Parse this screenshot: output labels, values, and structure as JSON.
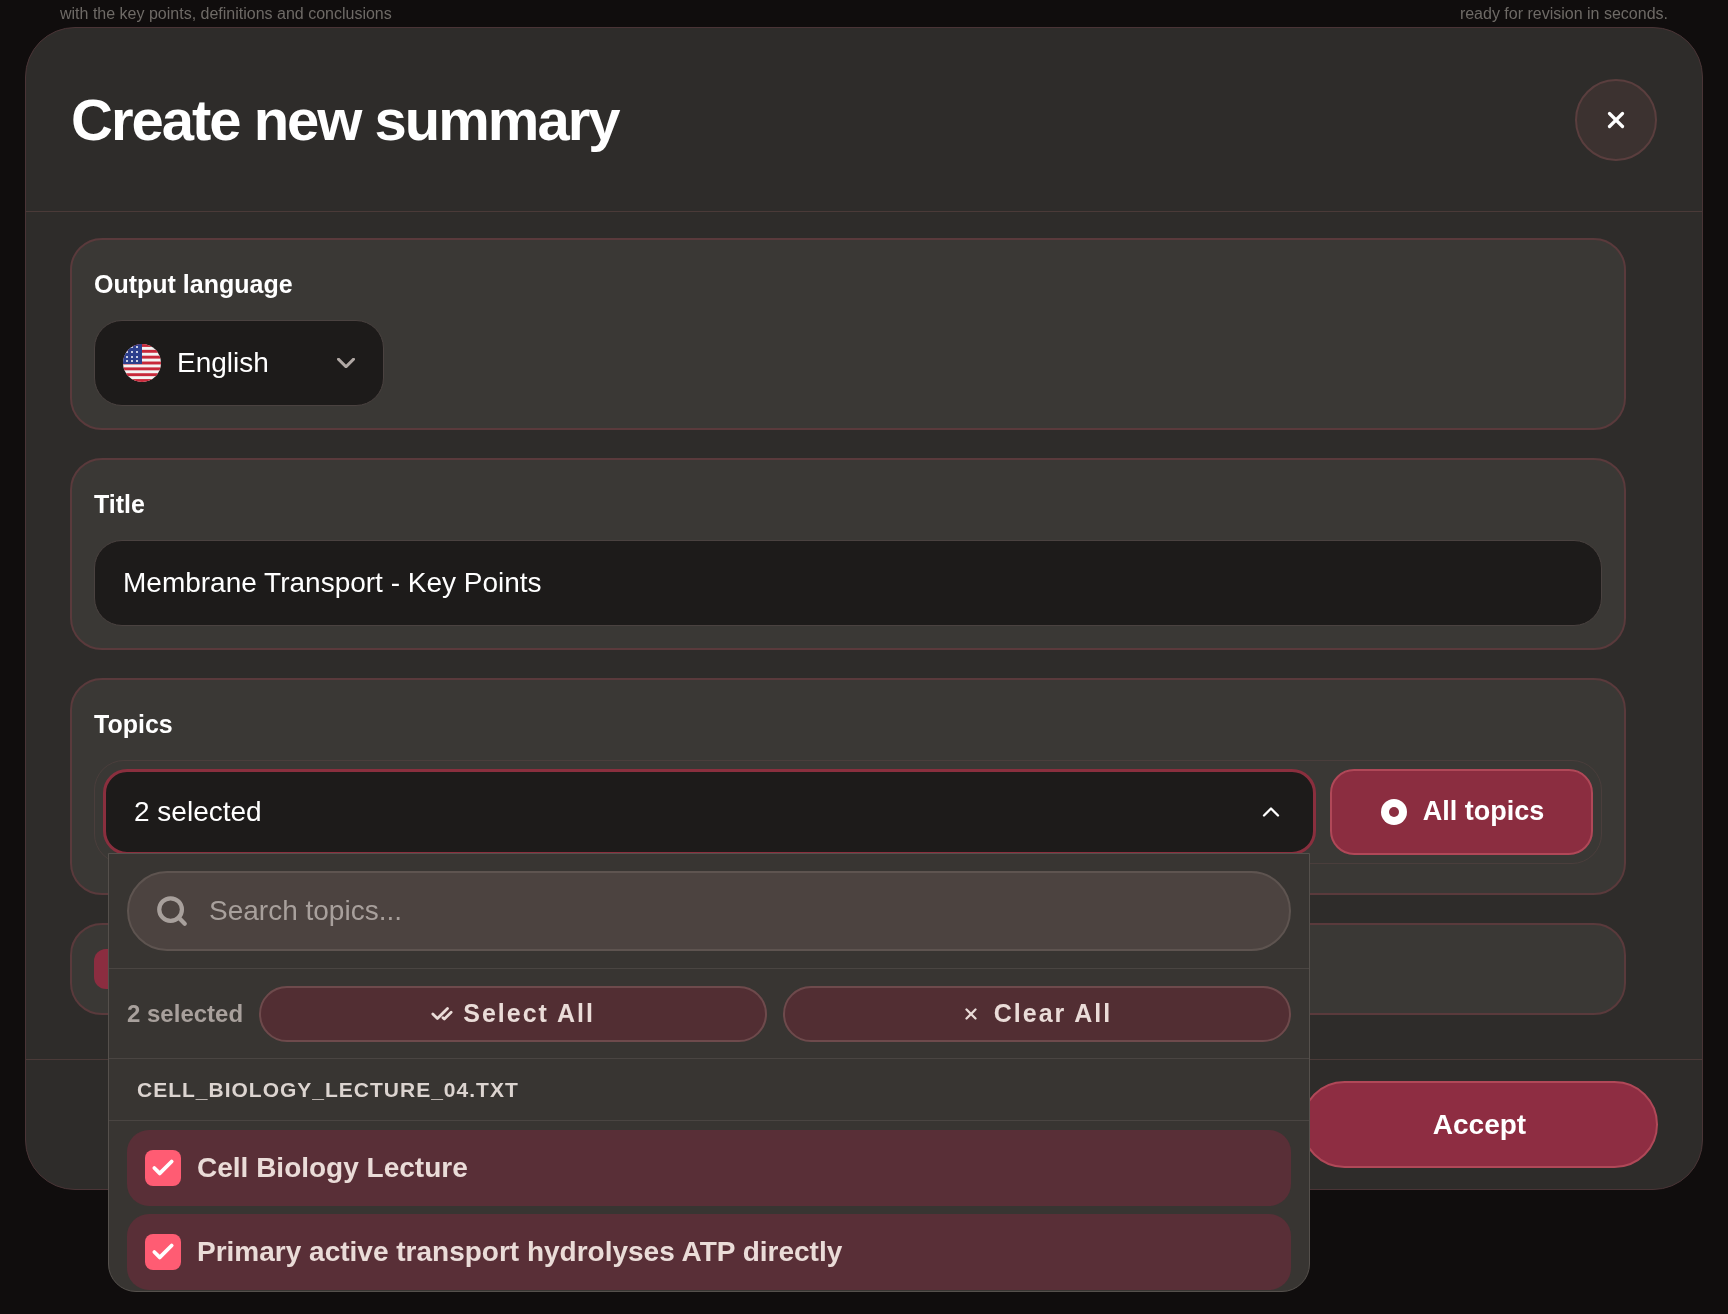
{
  "background_text": [
    "with the key points, definitions and conclusions",
    "ready for revision in seconds."
  ],
  "dialog": {
    "title": "Create new summary"
  },
  "output_language": {
    "label": "Output language",
    "value": "English"
  },
  "title_field": {
    "label": "Title",
    "value": "Membrane Transport - Key Points"
  },
  "topics": {
    "label": "Topics",
    "summary": "2 selected",
    "expanded": true,
    "all_topics": "All topics"
  },
  "topic_menu": {
    "search_placeholder": "Search topics...",
    "count": "2 selected",
    "select_all": "Select All",
    "clear_all": "Clear All",
    "groups": [
      {
        "file": "CELL_BIOLOGY_LECTURE_04.TXT",
        "items": [
          {
            "label": "Cell Biology Lecture",
            "checked": true
          },
          {
            "label": "Primary active transport hydrolyses ATP directly",
            "checked": true
          }
        ]
      }
    ]
  },
  "footer": {
    "accept": "Accept"
  }
}
